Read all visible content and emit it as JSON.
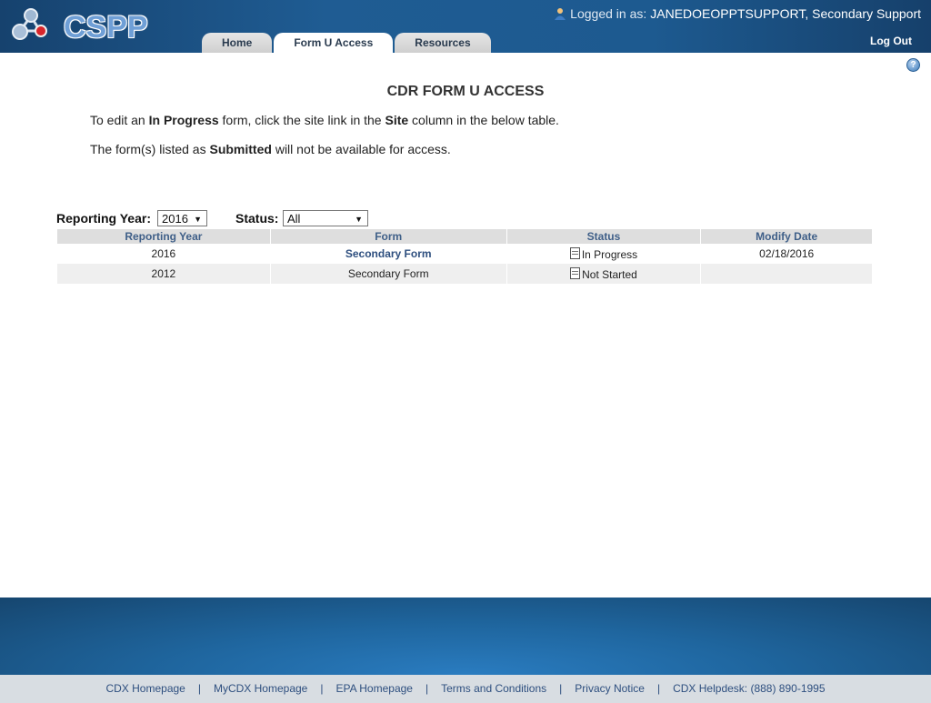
{
  "header": {
    "logo_text": "CSPP",
    "logged_in_prefix": "Logged in as:",
    "user_name": "JANEDOEOPPTSUPPORT, Secondary Support",
    "logout_label": "Log Out",
    "tabs": [
      {
        "label": "Home",
        "active": false
      },
      {
        "label": "Form U Access",
        "active": true
      },
      {
        "label": "Resources",
        "active": false
      }
    ]
  },
  "help_icon": "question-icon",
  "page": {
    "title": "CDR FORM U ACCESS",
    "instruction1": {
      "pre": "To edit an ",
      "b1": "In Progress",
      "mid": " form, click the site link in the ",
      "b2": "Site",
      "post": " column in the below table."
    },
    "instruction2": {
      "pre": "The form(s) listed as ",
      "b1": "Submitted",
      "post": " will not be available for access."
    }
  },
  "filters": {
    "year_label": "Reporting Year:",
    "year_value": "2016",
    "status_label": "Status:",
    "status_value": "All"
  },
  "table": {
    "headers": [
      "Reporting Year",
      "Form",
      "Status",
      "Modify Date"
    ],
    "rows": [
      {
        "year": "2016",
        "form": "Secondary Form",
        "status": "In Progress",
        "date": "02/18/2016"
      },
      {
        "year": "2012",
        "form": "Secondary Form",
        "status": "Not Started",
        "date": ""
      }
    ]
  },
  "footer": {
    "links": [
      "CDX Homepage",
      "MyCDX Homepage",
      "EPA Homepage",
      "Terms and Conditions",
      "Privacy Notice",
      "CDX Helpdesk: (888) 890-1995"
    ],
    "separator": "|"
  }
}
